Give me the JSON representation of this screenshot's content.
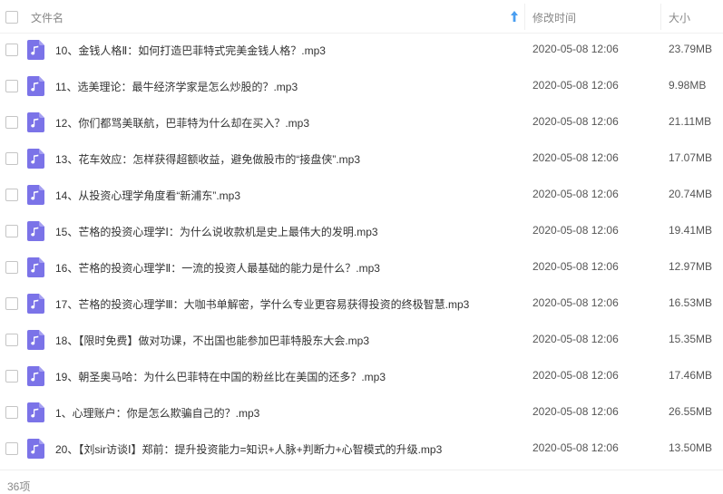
{
  "header": {
    "name_label": "文件名",
    "time_label": "修改时间",
    "size_label": "大小",
    "sort_icon": "arrow-up-icon"
  },
  "files": [
    {
      "name": "10、金钱人格Ⅱ：如何打造巴菲特式完美金钱人格？.mp3",
      "time": "2020-05-08 12:06",
      "size": "23.79MB"
    },
    {
      "name": "11、选美理论：最牛经济学家是怎么炒股的？.mp3",
      "time": "2020-05-08 12:06",
      "size": "9.98MB"
    },
    {
      "name": "12、你们都骂美联航，巴菲特为什么却在买入？.mp3",
      "time": "2020-05-08 12:06",
      "size": "21.11MB"
    },
    {
      "name": "13、花车效应：怎样获得超额收益，避免做股市的“接盘侠”.mp3",
      "time": "2020-05-08 12:06",
      "size": "17.07MB"
    },
    {
      "name": "14、从投资心理学角度看“新浦东”.mp3",
      "time": "2020-05-08 12:06",
      "size": "20.74MB"
    },
    {
      "name": "15、芒格的投资心理学Ⅰ：为什么说收款机是史上最伟大的发明.mp3",
      "time": "2020-05-08 12:06",
      "size": "19.41MB"
    },
    {
      "name": "16、芒格的投资心理学Ⅱ：一流的投资人最基础的能力是什么？.mp3",
      "time": "2020-05-08 12:06",
      "size": "12.97MB"
    },
    {
      "name": "17、芒格的投资心理学Ⅲ：大咖书单解密，学什么专业更容易获得投资的终极智慧.mp3",
      "time": "2020-05-08 12:06",
      "size": "16.53MB"
    },
    {
      "name": "18、【限时免费】做对功课，不出国也能参加巴菲特股东大会.mp3",
      "time": "2020-05-08 12:06",
      "size": "15.35MB"
    },
    {
      "name": "19、朝圣奥马哈：为什么巴菲特在中国的粉丝比在美国的还多？.mp3",
      "time": "2020-05-08 12:06",
      "size": "17.46MB"
    },
    {
      "name": "1、心理账户：你是怎么欺骗自己的？.mp3",
      "time": "2020-05-08 12:06",
      "size": "26.55MB"
    },
    {
      "name": "20、【刘sir访谈Ⅰ】郑前：提升投资能力=知识+人脉+判断力+心智模式的升级.mp3",
      "time": "2020-05-08 12:06",
      "size": "13.50MB"
    }
  ],
  "footer": {
    "count": "36项"
  },
  "colors": {
    "audio_icon": "#7b73e8",
    "sort_arrow": "#4a9ef0"
  },
  "icons": {
    "file": "audio-file-icon",
    "checkbox": "checkbox-icon"
  }
}
